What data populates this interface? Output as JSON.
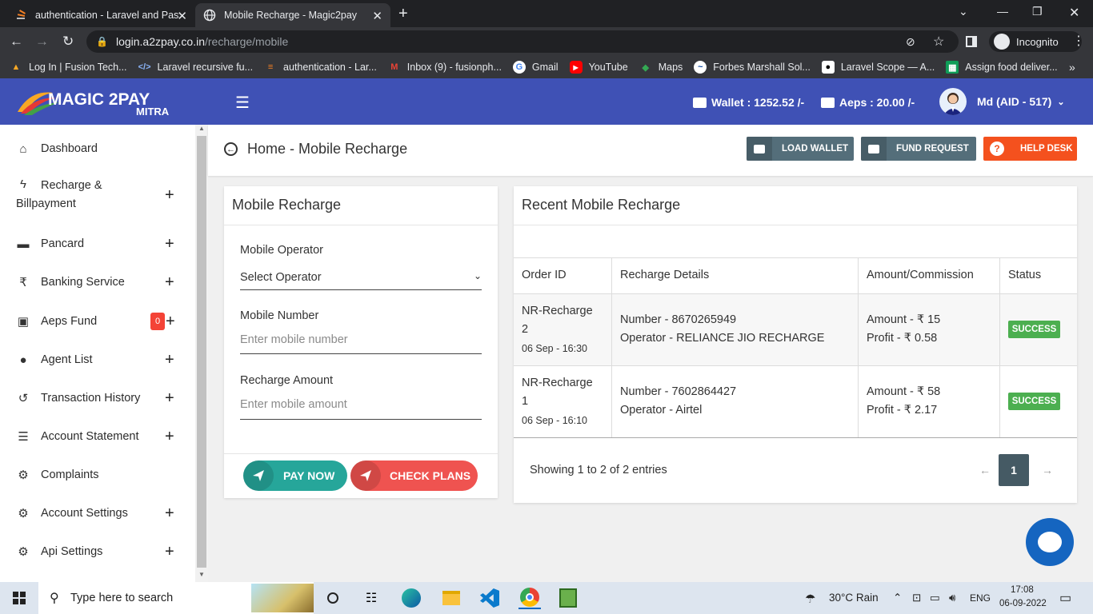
{
  "browser": {
    "tabs": [
      {
        "title": "authentication - Laravel and Pass"
      },
      {
        "title": "Mobile Recharge - Magic2pay"
      }
    ],
    "url_host": "login.a2zpay.co.in",
    "url_path": "/recharge/mobile",
    "incognito_label": "Incognito",
    "bookmarks": [
      "Log In | Fusion Tech...",
      "Laravel recursive fu...",
      "authentication - Lar...",
      "Inbox (9) - fusionph...",
      "Gmail",
      "YouTube",
      "Maps",
      "Forbes Marshall Sol...",
      "Laravel Scope — A...",
      "Assign food deliver..."
    ]
  },
  "header": {
    "logo_main": "MAGIC 2PAY",
    "logo_sub": "MITRA",
    "wallet": "Wallet : 1252.52 /-",
    "aeps": "Aeps : 20.00 /-",
    "user": "Md (AID - 517)"
  },
  "sidebar": {
    "items": [
      {
        "label": "Dashboard",
        "icon": "home-icon"
      },
      {
        "label": "Recharge &",
        "label2": "Billpayment",
        "icon": "bolt-icon"
      },
      {
        "label": "Pancard",
        "icon": "card-icon"
      },
      {
        "label": "Banking Service",
        "icon": "rupee-icon"
      },
      {
        "label": "Aeps Fund",
        "icon": "wallet-icon",
        "badge": "0"
      },
      {
        "label": "Agent List",
        "icon": "person-icon"
      },
      {
        "label": "Transaction History",
        "icon": "history-icon"
      },
      {
        "label": "Account Statement",
        "icon": "list-icon"
      },
      {
        "label": "Complaints",
        "icon": "gear-icon"
      },
      {
        "label": "Account Settings",
        "icon": "gear-icon"
      },
      {
        "label": "Api Settings",
        "icon": "gear-icon"
      }
    ]
  },
  "page": {
    "breadcrumb": "Home - Mobile Recharge",
    "buttons": {
      "load_wallet": "LOAD WALLET",
      "fund_request": "FUND REQUEST",
      "help_desk": "HELP DESK"
    }
  },
  "form": {
    "title": "Mobile Recharge",
    "operator_label": "Mobile Operator",
    "operator_value": "Select Operator",
    "number_label": "Mobile Number",
    "number_placeholder": "Enter mobile number",
    "amount_label": "Recharge Amount",
    "amount_placeholder": "Enter mobile amount",
    "pay_now": "PAY NOW",
    "check_plans": "CHECK PLANS"
  },
  "recent": {
    "title": "Recent Mobile Recharge",
    "columns": [
      "Order ID",
      "Recharge Details",
      "Amount/Commission",
      "Status"
    ],
    "rows": [
      {
        "order": "NR-Recharge",
        "order_no": "2",
        "date": "06 Sep - 16:30",
        "number": "Number - 8670265949",
        "operator": "Operator - RELIANCE JIO RECHARGE",
        "amount": "Amount - ₹ 15",
        "profit": "Profit - ₹ 0.58",
        "status": "SUCCESS"
      },
      {
        "order": "NR-Recharge",
        "order_no": "1",
        "date": "06 Sep - 16:10",
        "number": "Number - 7602864427",
        "operator": "Operator - Airtel",
        "amount": "Amount - ₹ 58",
        "profit": "Profit - ₹ 2.17",
        "status": "SUCCESS"
      }
    ],
    "info": "Showing 1 to 2 of 2 entries",
    "page": "1"
  },
  "taskbar": {
    "search": "Type here to search",
    "weather": "30°C  Rain",
    "lang": "ENG",
    "time": "17:08",
    "date": "06-09-2022"
  }
}
